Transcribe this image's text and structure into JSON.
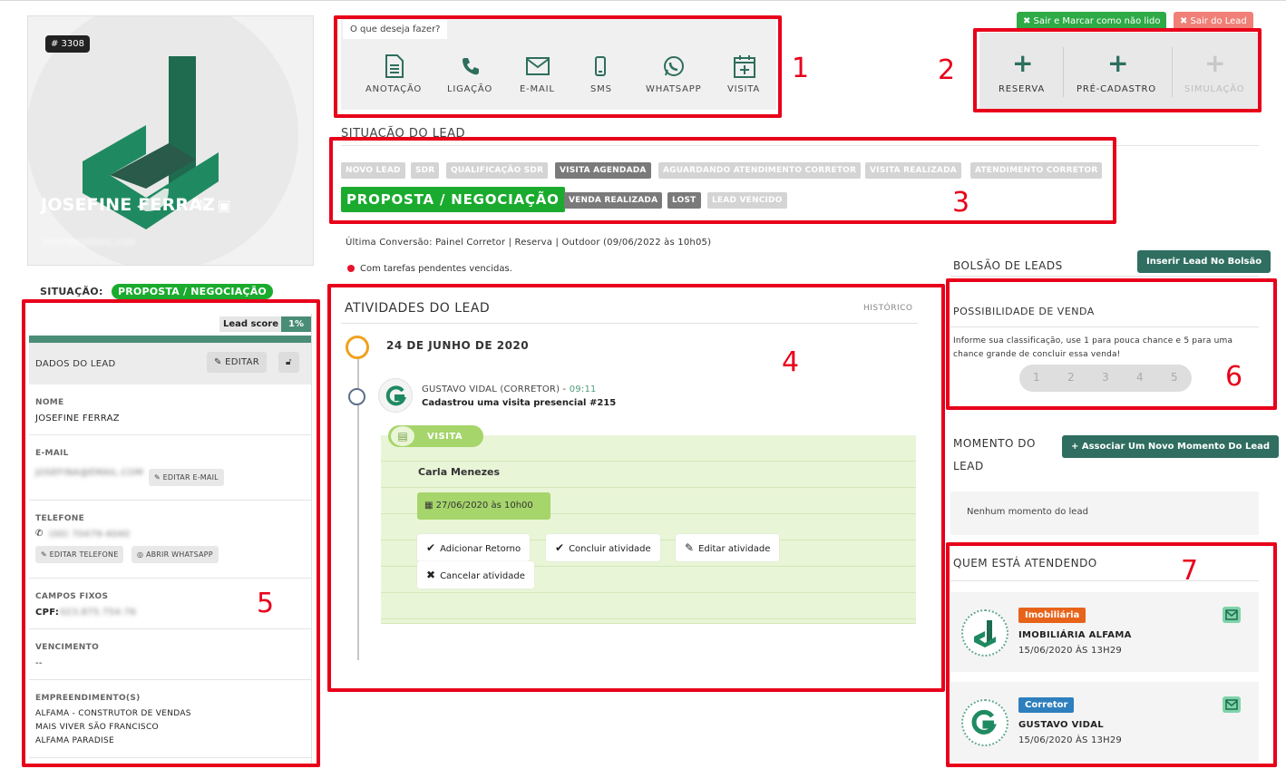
{
  "profile": {
    "lead_id": "# 3308",
    "name": "JOSEFINE FERRAZ",
    "email_masked": "JOSEFINA@EMAIL.COM",
    "situacao_label": "SITUAÇÃO:",
    "situacao_value": "PROPOSTA / NEGOCIAÇÃO"
  },
  "lead_score": {
    "label": "Lead score",
    "value": "1%"
  },
  "dados": {
    "title": "DADOS DO LEAD",
    "edit_label": "EDITAR",
    "nome_label": "NOME",
    "nome_value": "JOSEFINE FERRAZ",
    "email_label": "E-MAIL",
    "email_value": "JOSEFINA@EMAIL.COM",
    "edit_email_label": "EDITAR E-MAIL",
    "telefone_label": "TELEFONE",
    "telefone_value": "(00) 70479-4040",
    "edit_phone_label": "EDITAR TELEFONE",
    "whatsapp_label": "ABRIR WHATSAPP",
    "campos_label": "CAMPOS FIXOS",
    "cpf_label": "CPF:",
    "cpf_value": "023.875.754-76",
    "vencimento_label": "VENCIMENTO",
    "vencimento_value": "--",
    "empreendimentos_label": "EMPREENDIMENTO(S)",
    "empreendimentos": [
      "ALFAMA - CONSTRUTOR DE VENDAS",
      "MAIS VIVER SÃO FRANCISCO",
      "ALFAMA PARADISE"
    ]
  },
  "actions": {
    "prompt": "O que deseja fazer?",
    "items": [
      "ANOTAÇÃO",
      "LIGAÇÃO",
      "E-MAIL",
      "SMS",
      "WHATSAPP",
      "VISITA"
    ]
  },
  "right_actions": {
    "items": [
      "RESERVA",
      "PRÉ-CADASTRO",
      "SIMULAÇÃO"
    ]
  },
  "top_buttons": {
    "mark_unread": "✖ Sair e Marcar como não lido",
    "exit": "✖ Sair do Lead"
  },
  "situacao": {
    "title": "SITUAÇÃO DO LEAD",
    "stages": [
      "NOVO LEAD",
      "SDR",
      "QUALIFICAÇÃO SDR",
      "VISITA AGENDADA",
      "AGUARDANDO ATENDIMENTO CORRETOR",
      "VISITA REALIZADA",
      "ATENDIMENTO CORRETOR",
      "PROPOSTA / NEGOCIAÇÃO",
      "VENDA REALIZADA",
      "LOST",
      "LEAD VENCIDO"
    ]
  },
  "conversion": {
    "text": "Última Conversão: Painel Corretor | Reserva | Outdoor (09/06/2022 às 10h05)",
    "pending": "Com tarefas pendentes vencidas."
  },
  "atividades": {
    "title": "ATIVIDADES DO LEAD",
    "historico": "HISTÓRICO",
    "date": "24 DE JUNHO DE 2020",
    "author": "GUSTAVO VIDAL (CORRETOR)",
    "time": "09:11",
    "description": "Cadastrou uma visita presencial #215",
    "visita_label": "VISITA",
    "visita_name": "Carla Menezes",
    "visita_date": "27/06/2020 às 10h00",
    "btn_retorno": "Adicionar Retorno",
    "btn_concluir": "Concluir atividade",
    "btn_editar": "Editar atividade",
    "btn_cancelar": "Cancelar atividade"
  },
  "bolsao": {
    "title": "BOLSÃO DE LEADS",
    "button": "Inserir Lead No Bolsão"
  },
  "possibilidade": {
    "title": "POSSIBILIDADE DE VENDA",
    "text": "Informe sua classificação, use 1 para pouca chance e 5 para uma chance grande de concluir essa venda!",
    "ratings": [
      "1",
      "2",
      "3",
      "4",
      "5"
    ]
  },
  "momento": {
    "title_line1": "MOMENTO DO",
    "title_line2": "LEAD",
    "button": "+ Associar Um Novo Momento Do Lead",
    "empty": "Nenhum momento do lead"
  },
  "atendendo": {
    "title": "QUEM ESTÁ ATENDENDO",
    "cards": [
      {
        "badge": "Imobiliária",
        "name": "IMOBILIÁRIA ALFAMA",
        "date": "15/06/2020 ÀS 13H29"
      },
      {
        "badge": "Corretor",
        "name": "GUSTAVO VIDAL",
        "date": "15/06/2020 ÀS 13H29"
      }
    ]
  },
  "annotations": [
    "1",
    "2",
    "3",
    "4",
    "5",
    "6",
    "7"
  ],
  "colors": {
    "brand_green": "#1aab2e",
    "teal": "#2f6e60",
    "annotation_red": "#e8001a",
    "imobiliaria_badge": "#e8631a",
    "corretor_badge": "#2e7fbd"
  }
}
